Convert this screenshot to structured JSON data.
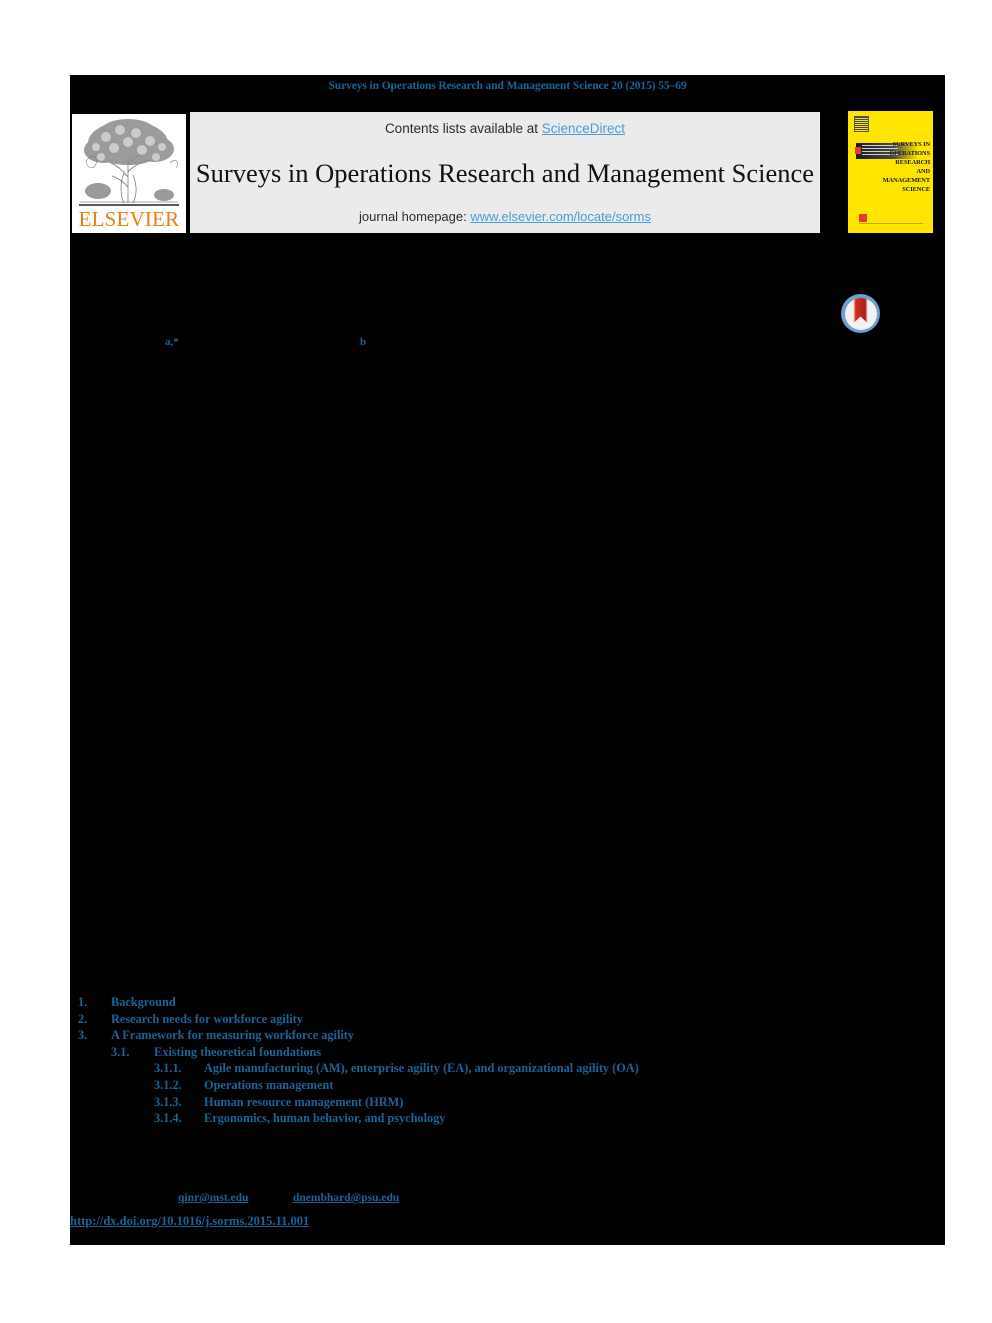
{
  "running_head": "Surveys in Operations Research and Management Science 20 (2015) 55–69",
  "elsevier_logo": {
    "wordmark": "ELSEVIER",
    "icon": "elsevier-tree-logo",
    "accent_color": "#ee7d11"
  },
  "banner": {
    "contents_prefix": "Contents lists available at ",
    "contents_link": "ScienceDirect",
    "journal_title": "Surveys in Operations Research and Management Science",
    "homepage_prefix": "journal homepage: ",
    "homepage_link": "www.elsevier.com/locate/sorms",
    "background_color": "#ebebeb",
    "link_color": "#4a9bd5"
  },
  "journal_cover": {
    "title_lines": [
      "SURVEYS IN",
      "OPERATIONS RESEARCH",
      "AND MANAGEMENT SCIENCE"
    ],
    "background_color": "#ffe400",
    "accent_color": "#e33b2e"
  },
  "crossmark": {
    "icon": "crossmark-logo",
    "ring_color": "#6e9fcf",
    "mark_color": "#cf2f22"
  },
  "authors": {
    "marks": [
      {
        "id": "a",
        "text": "a,*"
      },
      {
        "id": "b",
        "text": "b"
      }
    ],
    "mark_color": "#1a6496"
  },
  "toc": {
    "entries": [
      {
        "level": 1,
        "number": "1.",
        "label": "Background"
      },
      {
        "level": 1,
        "number": "2.",
        "label": "Research needs for workforce agility"
      },
      {
        "level": 1,
        "number": "3.",
        "label": "A Framework for measuring workforce agility"
      },
      {
        "level": 2,
        "number": "3.1.",
        "label": "Existing theoretical foundations"
      },
      {
        "level": 3,
        "number": "3.1.1.",
        "label": "Agile manufacturing (AM), enterprise agility (EA), and organizational agility (OA)"
      },
      {
        "level": 3,
        "number": "3.1.2.",
        "label": "Operations management"
      },
      {
        "level": 3,
        "number": "3.1.3.",
        "label": "Human resource management (HRM)"
      },
      {
        "level": 3,
        "number": "3.1.4.",
        "label": "Ergonomics, human behavior, and psychology"
      }
    ],
    "text_color": "#1a6496"
  },
  "footer": {
    "email_corresponding": "qinr@mst.edu",
    "email_second": "dnembhard@psu.edu",
    "doi": "http://dx.doi.org/10.1016/j.sorms.2015.11.001",
    "link_color": "#1a6496"
  },
  "redaction": {
    "color": "#000000"
  }
}
